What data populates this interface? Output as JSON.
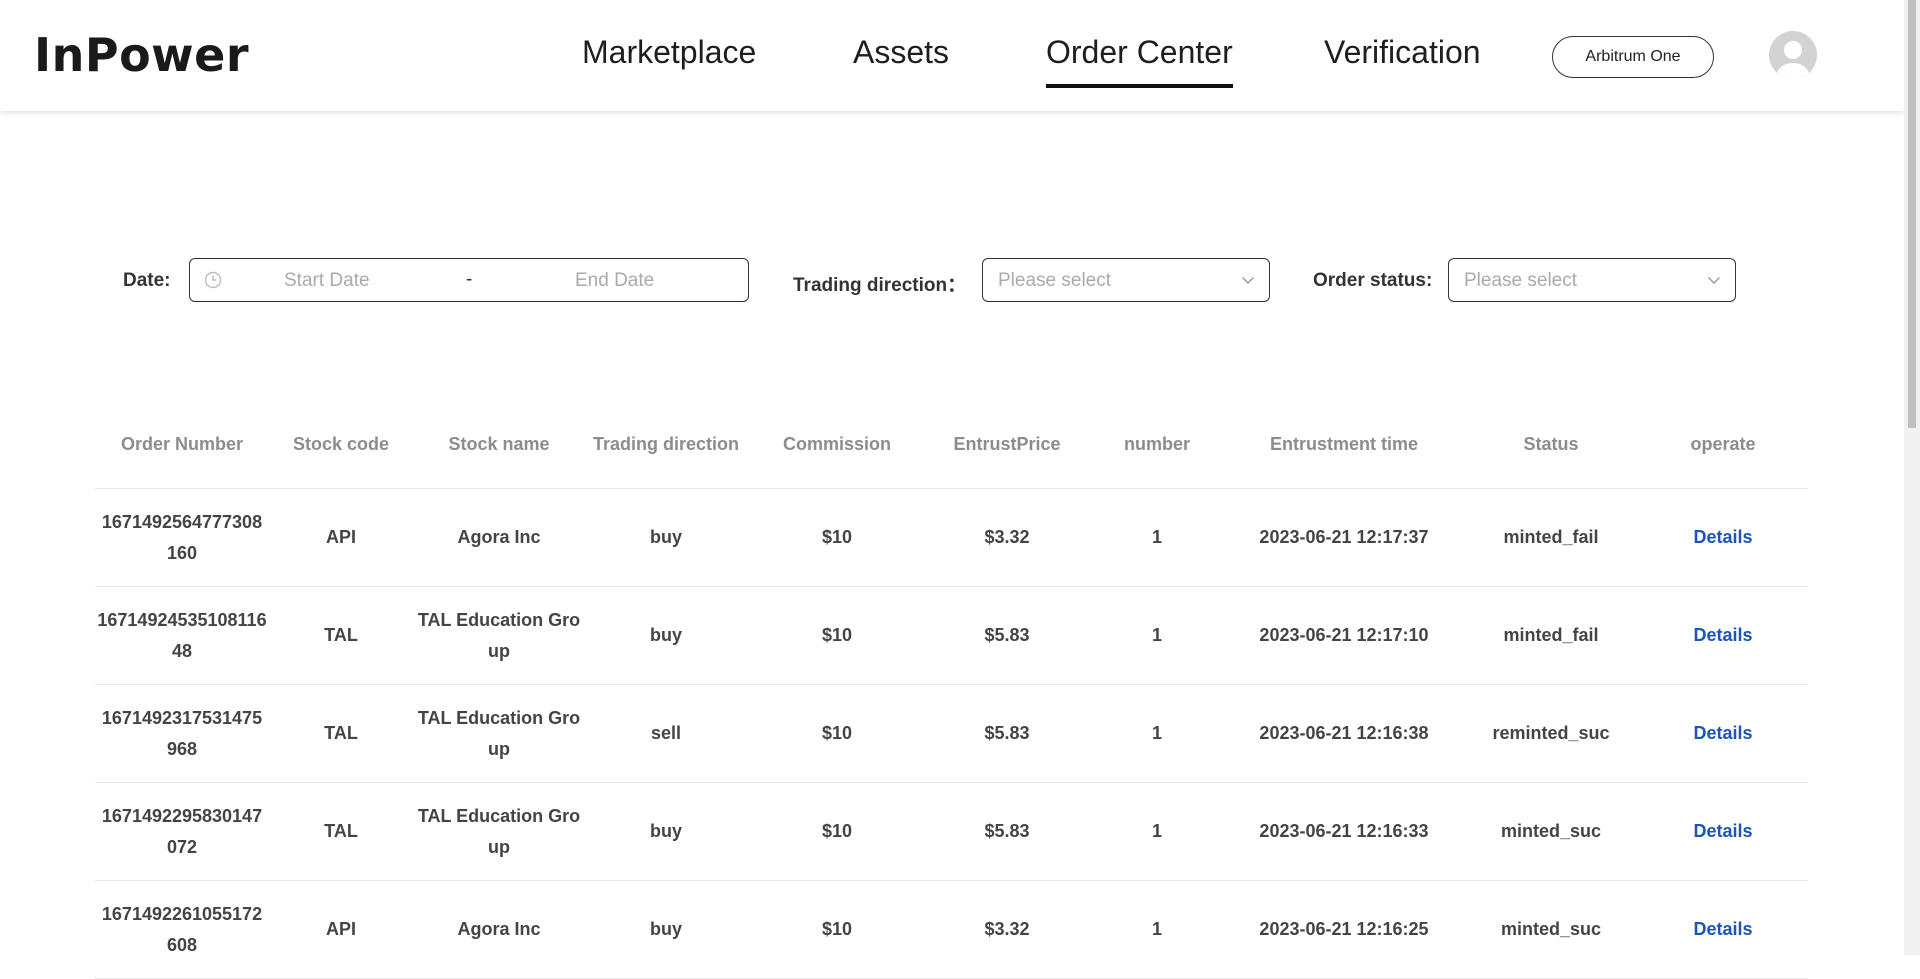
{
  "header": {
    "logo": "InPower",
    "nav": [
      {
        "label": "Marketplace"
      },
      {
        "label": "Assets"
      },
      {
        "label": "Order Center",
        "active": true
      },
      {
        "label": "Verification"
      }
    ],
    "network_button": "Arbitrum One",
    "avatar_icon": "user-avatar-icon"
  },
  "filters": {
    "date_label": "Date:",
    "start_placeholder": "Start Date",
    "separator": "-",
    "end_placeholder": "End Date",
    "direction_label": "Trading direction：",
    "direction_placeholder": "Please select",
    "status_label": "Order status:",
    "status_placeholder": "Please select"
  },
  "table": {
    "columns": [
      "Order Number",
      "Stock code",
      "Stock name",
      "Trading direction",
      "Commission",
      "EntrustPrice",
      "number",
      "Entrustment time",
      "Status",
      "operate"
    ],
    "rows": [
      {
        "order_number": "1671492564777308160",
        "stock_code": "API",
        "stock_name": "Agora Inc",
        "direction": "buy",
        "commission": "$10",
        "price": "$3.32",
        "number": "1",
        "time": "2023-06-21 12:17:37",
        "status": "minted_fail",
        "action": "Details"
      },
      {
        "order_number": "1671492453510811648",
        "stock_code": "TAL",
        "stock_name": "TAL Education Group",
        "direction": "buy",
        "commission": "$10",
        "price": "$5.83",
        "number": "1",
        "time": "2023-06-21 12:17:10",
        "status": "minted_fail",
        "action": "Details"
      },
      {
        "order_number": "1671492317531475968",
        "stock_code": "TAL",
        "stock_name": "TAL Education Group",
        "direction": "sell",
        "commission": "$10",
        "price": "$5.83",
        "number": "1",
        "time": "2023-06-21 12:16:38",
        "status": "reminted_suc",
        "action": "Details"
      },
      {
        "order_number": "1671492295830147072",
        "stock_code": "TAL",
        "stock_name": "TAL Education Group",
        "direction": "buy",
        "commission": "$10",
        "price": "$5.83",
        "number": "1",
        "time": "2023-06-21 12:16:33",
        "status": "minted_suc",
        "action": "Details"
      },
      {
        "order_number": "1671492261055172608",
        "stock_code": "API",
        "stock_name": "Agora Inc",
        "direction": "buy",
        "commission": "$10",
        "price": "$3.32",
        "number": "1",
        "time": "2023-06-21 12:16:25",
        "status": "minted_suc",
        "action": "Details"
      }
    ]
  }
}
